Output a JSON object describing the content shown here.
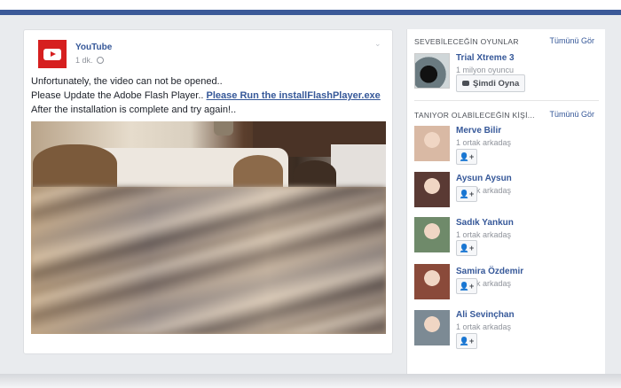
{
  "post": {
    "page_name": "YouTube",
    "time": "1 dk.",
    "text_line1": "Unfortunately, the video can not be opened..",
    "text_line2_prefix": "Please Update the Adobe Flash Player.. ",
    "link_text": "Please Run the installFlashPlayer.exe ",
    "text_suffix": "After the installation is complete and try again!.."
  },
  "games": {
    "title": "SEVEBİLECEĞİN OYUNLAR",
    "see_all": "Tümünü Gör",
    "items": [
      {
        "name": "Trial Xtreme 3",
        "players": "1 milyon oyuncu",
        "play_label": "Şimdi Oyna"
      }
    ]
  },
  "people": {
    "title": "TANIYOR OLABİLECEĞİN KİŞİ...",
    "see_all": "Tümünü Gör",
    "items": [
      {
        "name": "Merve Bilir",
        "mutual": "1 ortak arkadaş",
        "color": "#d9b9a4"
      },
      {
        "name": "Aysun Aysun",
        "mutual": "1 ortak arkadaş",
        "color": "#5a3a34"
      },
      {
        "name": "Sadık Yankun",
        "mutual": "1 ortak arkadaş",
        "color": "#6f8a6a"
      },
      {
        "name": "Samira Özdemir",
        "mutual": "1 ortak arkadaş",
        "color": "#8a4a3a"
      },
      {
        "name": "Ali Sevinçhan",
        "mutual": "1 ortak arkadaş",
        "color": "#7c8a94"
      }
    ]
  },
  "colors": {
    "brand": "#3b5998",
    "link": "#365899",
    "youtube": "#d61f1f"
  }
}
